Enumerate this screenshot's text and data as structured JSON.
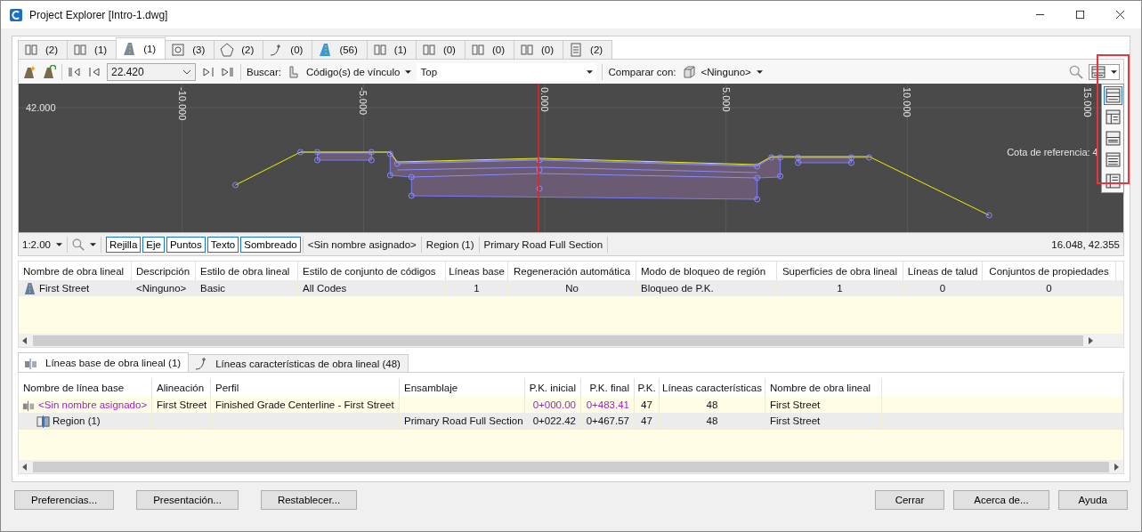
{
  "window": {
    "title": "Project Explorer [Intro-1.dwg]"
  },
  "tabs": [
    {
      "count": "(2)",
      "selected": false
    },
    {
      "count": "(1)",
      "selected": false
    },
    {
      "count": "(1)",
      "selected": true
    },
    {
      "count": "(3)",
      "selected": false
    },
    {
      "count": "(2)",
      "selected": false
    },
    {
      "count": "(0)",
      "selected": false
    },
    {
      "count": "(56)",
      "selected": false
    },
    {
      "count": "(1)",
      "selected": false
    },
    {
      "count": "(0)",
      "selected": false
    },
    {
      "count": "(0)",
      "selected": false
    },
    {
      "count": "(0)",
      "selected": false
    },
    {
      "count": "(2)",
      "selected": false
    }
  ],
  "toolbar": {
    "station": "22.420",
    "search_label": "Buscar:",
    "search_by": "Código(s) de vínculo",
    "search_value": "Top",
    "compare_label": "Comparar con:",
    "compare_value": "<Ninguno>"
  },
  "view_menu": {
    "items": [
      {
        "selected": true
      },
      {
        "selected": false
      },
      {
        "selected": false
      },
      {
        "selected": false
      },
      {
        "selected": false
      }
    ]
  },
  "section_view": {
    "x_labels": [
      "-10.000",
      "-5.000",
      "0.000",
      "5.000",
      "10.000",
      "15.000"
    ],
    "elevation_label": "42.000",
    "reference_label": "Cota de referencia: 4"
  },
  "section_status": {
    "scale": "1:2.00",
    "toggles": [
      {
        "label": "Rejilla",
        "on": true
      },
      {
        "label": "Eje",
        "on": true
      },
      {
        "label": "Puntos",
        "on": true
      },
      {
        "label": "Texto",
        "on": true
      },
      {
        "label": "Sombreado",
        "on": true
      }
    ],
    "info": [
      "<Sin nombre asignado>",
      "Region (1)",
      "Primary Road Full Section"
    ],
    "coordinates": "16.048, 42.355"
  },
  "corridor_table": {
    "columns": [
      "Nombre de obra lineal",
      "Descripción",
      "Estilo de obra lineal",
      "Estilo de conjunto de códigos",
      "Líneas base",
      "Regeneración automática",
      "Modo de bloqueo de región",
      "Superficies de obra lineal",
      "Líneas de talud",
      "Conjuntos de propiedades"
    ],
    "rows": [
      {
        "cells": [
          "First Street",
          "<Ninguno>",
          "Basic",
          "All Codes",
          "1",
          "No",
          "Bloqueo de P.K.",
          "1",
          "0",
          "0"
        ],
        "selected": true
      }
    ]
  },
  "detail_tabs": [
    {
      "label": "Líneas base de obra lineal (1)",
      "selected": true
    },
    {
      "label": "Líneas características de obra lineal (48)",
      "selected": false
    }
  ],
  "baseline_table": {
    "columns": [
      "Nombre de línea base",
      "Alineación",
      "Perfil",
      "Ensamblaje",
      "P.K. inicial",
      "P.K. final",
      "P.K.",
      "Líneas características",
      "Nombre de obra lineal"
    ],
    "rows": [
      {
        "kind": "baseline",
        "selected": false,
        "cells": [
          "<Sin nombre asignado>",
          "First Street",
          "Finished Grade Centerline - First Street",
          "",
          "0+000.00",
          "0+483.41",
          "47",
          "48",
          "First Street"
        ],
        "children": [
          {
            "kind": "region",
            "selected": true,
            "cells": [
              "Region (1)",
              "",
              "",
              "Primary Road Full Section",
              "0+022.42",
              "0+467.57",
              "47",
              "48",
              "First Street"
            ]
          }
        ]
      }
    ]
  },
  "buttons_left": [
    "Preferencias...",
    "Presentación...",
    "Restablecer..."
  ],
  "buttons_right": [
    "Cerrar",
    "Acerca de...",
    "Ayuda"
  ]
}
